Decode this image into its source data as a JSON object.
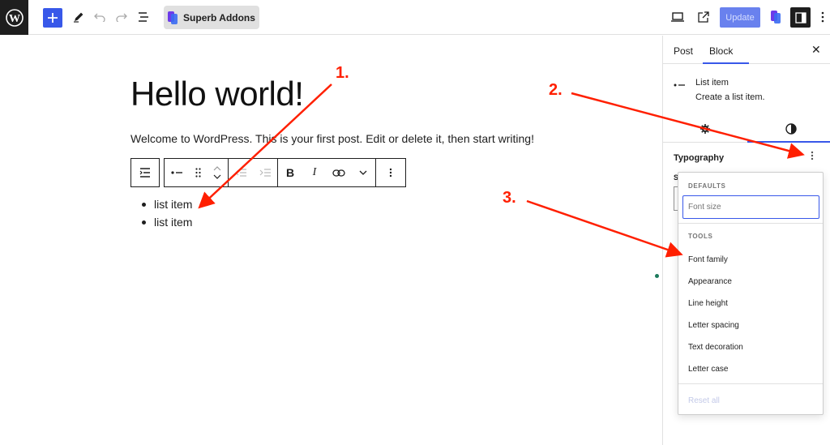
{
  "topbar": {
    "addon_label": "Superb Addons",
    "update_label": "Update",
    "icons": [
      "wordpress-logo",
      "plus-icon",
      "pencil-icon",
      "undo-icon",
      "redo-icon",
      "document-overview-icon",
      "preview-icon",
      "external-link-icon",
      "settings-sidebar-icon",
      "more-vertical-icon"
    ]
  },
  "post": {
    "title": "Hello world!",
    "paragraph": "Welcome to WordPress. This is your first post. Edit or delete it, then start writing!",
    "list": [
      "list item",
      "list item"
    ]
  },
  "block_toolbar": {
    "bold": "B",
    "italic": "I"
  },
  "sidebar": {
    "tabs": [
      "Post",
      "Block"
    ],
    "active_tab": "Block",
    "block_card": {
      "title": "List item",
      "description": "Create a list item."
    },
    "panel_title": "Typography",
    "size_label": "S"
  },
  "dropdown": {
    "defaults_heading": "DEFAULTS",
    "font_size_label": "Font size",
    "tools_heading": "TOOLS",
    "tools": [
      "Font family",
      "Appearance",
      "Line height",
      "Letter spacing",
      "Text decoration",
      "Letter case"
    ],
    "reset_label": "Reset all"
  },
  "annotations": [
    "1.",
    "2.",
    "3."
  ],
  "colors": {
    "accent": "#3858e9",
    "annotation": "#ff1f00",
    "dark": "#1e1e1e"
  }
}
